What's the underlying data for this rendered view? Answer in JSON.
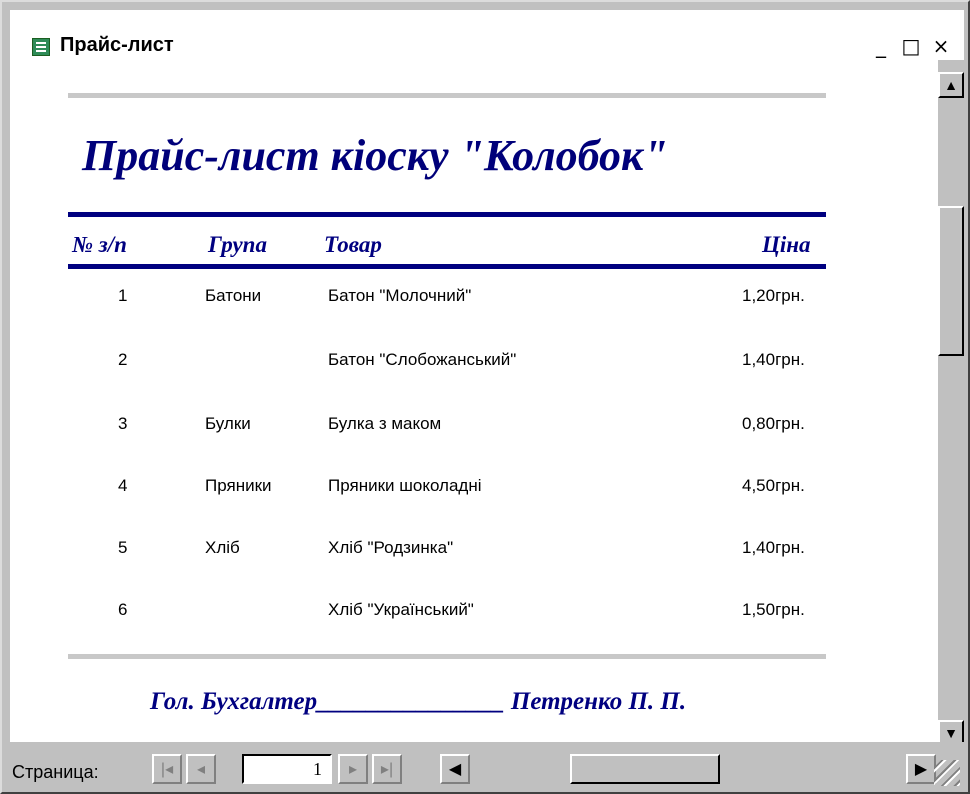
{
  "window": {
    "title": "Прайс-лист",
    "min": "_",
    "max": "□",
    "close": "×"
  },
  "report": {
    "title": "Прайс-лист кіоску \"Колобок\"",
    "headers": {
      "num": "№ з/п",
      "group": "Група",
      "product": "Товар",
      "price": "Ціна"
    },
    "rows": [
      {
        "num": "1",
        "group": "Батони",
        "product": "Батон \"Молочний\"",
        "price": "1,20грн."
      },
      {
        "num": "2",
        "group": "",
        "product": "Батон \"Слобожанський\"",
        "price": "1,40грн."
      },
      {
        "num": "3",
        "group": "Булки",
        "product": "Булка з маком",
        "price": "0,80грн."
      },
      {
        "num": "4",
        "group": "Пряники",
        "product": "Пряники шоколадні",
        "price": "4,50грн."
      },
      {
        "num": "5",
        "group": "Хліб",
        "product": "Хліб \"Родзинка\"",
        "price": "1,40грн."
      },
      {
        "num": "6",
        "group": "",
        "product": "Хліб \"Український\"",
        "price": "1,50грн."
      }
    ],
    "footer": "Гол. Бухгалтер_______________ Петренко П. П."
  },
  "statusbar": {
    "page_label": "Страница:",
    "page_value": "1",
    "first": "|◂",
    "prev": "◂",
    "next": "▸",
    "last": "▸|"
  },
  "scroll": {
    "up": "▲",
    "down": "▼",
    "left": "◀",
    "right": "▶"
  },
  "colors": {
    "title_text": "#00007a",
    "rule_navy": "#000080",
    "rule_gray": "#c8c8c8"
  }
}
